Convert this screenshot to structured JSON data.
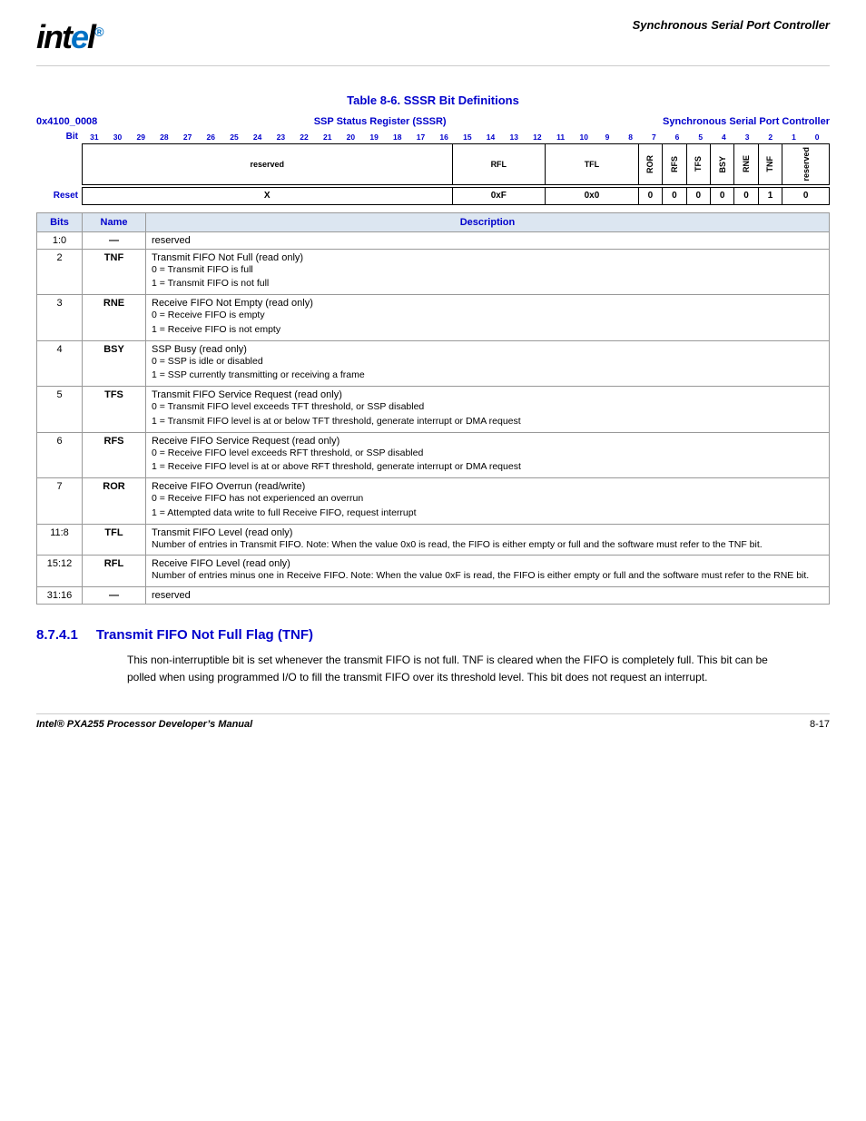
{
  "header": {
    "logo": "int•l",
    "title": "Synchronous Serial Port Controller"
  },
  "table_section": {
    "title": "Table 8-6. SSSR Bit Definitions",
    "register_address": "0x4100_0008",
    "register_name": "SSP Status Register (SSSR)",
    "register_controller": "Synchronous Serial Port Controller",
    "bit_label": "Bit",
    "bit_numbers": [
      "31",
      "30",
      "29",
      "28",
      "27",
      "26",
      "25",
      "24",
      "23",
      "22",
      "21",
      "20",
      "19",
      "18",
      "17",
      "16",
      "15",
      "14",
      "13",
      "12",
      "11",
      "10",
      "9",
      "8",
      "7",
      "6",
      "5",
      "4",
      "3",
      "2",
      "1",
      "0"
    ],
    "reset_label": "Reset",
    "fields": [
      {
        "label": "reserved",
        "bits": 16,
        "colspan": 16
      },
      {
        "label": "RFL",
        "bits": 4,
        "colspan": 4
      },
      {
        "label": "TFL",
        "bits": 4,
        "colspan": 4
      },
      {
        "label": "ROR",
        "bits": 1,
        "colspan": 1,
        "rotated": true
      },
      {
        "label": "RFS",
        "bits": 1,
        "colspan": 1,
        "rotated": true
      },
      {
        "label": "TFS",
        "bits": 1,
        "colspan": 1,
        "rotated": true
      },
      {
        "label": "BSY",
        "bits": 1,
        "colspan": 1,
        "rotated": true
      },
      {
        "label": "RNE",
        "bits": 1,
        "colspan": 1,
        "rotated": true
      },
      {
        "label": "TNF",
        "bits": 1,
        "colspan": 1,
        "rotated": true
      },
      {
        "label": "reserved",
        "bits": 2,
        "colspan": 2,
        "rotated": true
      }
    ],
    "reset_values": [
      {
        "label": "X",
        "colspan": 16
      },
      {
        "label": "0xF",
        "colspan": 4
      },
      {
        "label": "0x0",
        "colspan": 4
      },
      {
        "label": "0",
        "colspan": 1
      },
      {
        "label": "0",
        "colspan": 1
      },
      {
        "label": "0",
        "colspan": 1
      },
      {
        "label": "0",
        "colspan": 1
      },
      {
        "label": "0",
        "colspan": 1
      },
      {
        "label": "1",
        "colspan": 1
      },
      {
        "label": "0",
        "colspan": 2
      }
    ],
    "table_headers": [
      "Bits",
      "Name",
      "Description"
    ],
    "rows": [
      {
        "bits": "1:0",
        "name": "—",
        "desc_title": "reserved",
        "desc_body": ""
      },
      {
        "bits": "2",
        "name": "TNF",
        "desc_title": "Transmit FIFO Not Full (read only)",
        "desc_body": "0 =  Transmit FIFO is full\n1 =  Transmit FIFO is not full"
      },
      {
        "bits": "3",
        "name": "RNE",
        "desc_title": "Receive FIFO Not Empty (read only)",
        "desc_body": "0 =  Receive FIFO is empty\n1 =  Receive FIFO is not empty"
      },
      {
        "bits": "4",
        "name": "BSY",
        "desc_title": "SSP Busy (read only)",
        "desc_body": "0 =  SSP is idle or disabled\n1 =  SSP currently transmitting or receiving a frame"
      },
      {
        "bits": "5",
        "name": "TFS",
        "desc_title": "Transmit FIFO Service Request (read only)",
        "desc_body": "0 =  Transmit FIFO level exceeds TFT threshold, or SSP disabled\n1 =  Transmit FIFO level is at or below TFT threshold, generate interrupt or DMA request"
      },
      {
        "bits": "6",
        "name": "RFS",
        "desc_title": "Receive FIFO Service Request (read only)",
        "desc_body": "0 =  Receive FIFO level exceeds RFT threshold, or SSP disabled\n1 =  Receive FIFO level is at or above RFT threshold, generate interrupt or DMA request"
      },
      {
        "bits": "7",
        "name": "ROR",
        "desc_title": "Receive FIFO Overrun (read/write)",
        "desc_body": "0 =  Receive FIFO has not experienced an overrun\n1 =  Attempted data write to full Receive FIFO, request interrupt"
      },
      {
        "bits": "11:8",
        "name": "TFL",
        "desc_title": "Transmit FIFO Level (read only)",
        "desc_body": "Number of entries in Transmit FIFO. Note: When the value 0x0 is read, the FIFO is either empty or full and the software must refer to the TNF bit."
      },
      {
        "bits": "15:12",
        "name": "RFL",
        "desc_title": "Receive FIFO Level (read only)",
        "desc_body": "Number of entries minus one in Receive FIFO. Note: When the value 0xF is read, the FIFO is either empty or full and the software must refer to the RNE bit."
      },
      {
        "bits": "31:16",
        "name": "—",
        "desc_title": "reserved",
        "desc_body": ""
      }
    ]
  },
  "section_871": {
    "number": "8.7.4.1",
    "title": "Transmit FIFO Not Full Flag (TNF)",
    "body": "This non-interruptible bit is set whenever the transmit FIFO is not full. TNF is cleared when the FIFO is completely full. This bit can be polled when using programmed I/O to fill the transmit FIFO over its threshold level. This bit does not request an interrupt."
  },
  "footer": {
    "left": "Intel® PXA255 Processor Developer’s Manual",
    "right": "8-17"
  }
}
